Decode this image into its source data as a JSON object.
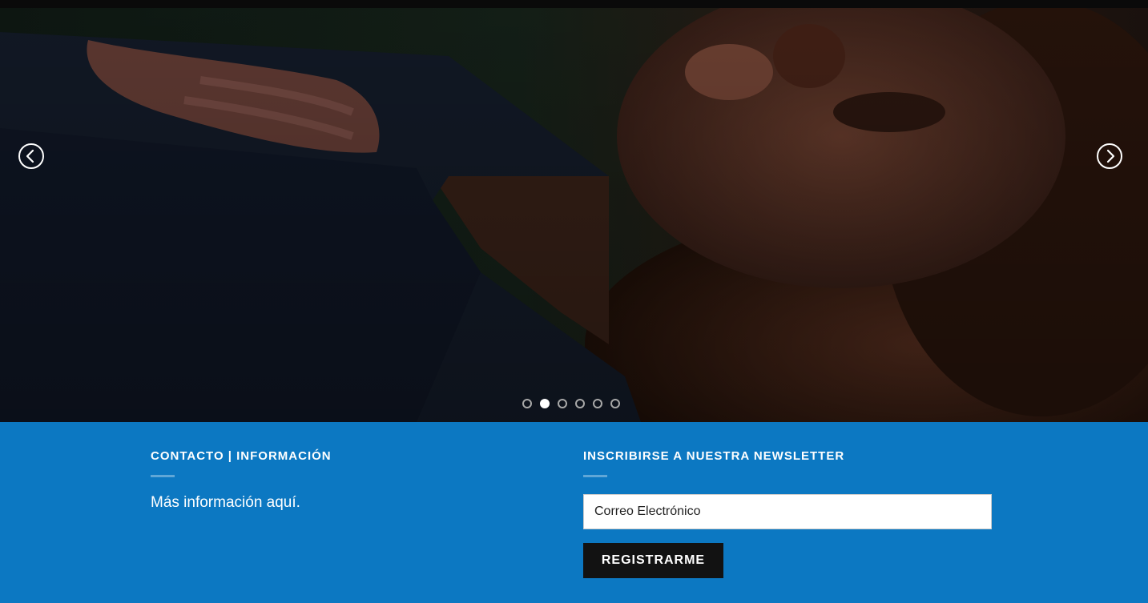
{
  "slider": {
    "prev_icon": "chevron-left-icon",
    "next_icon": "chevron-right-icon",
    "slides": [
      {
        "active": false
      },
      {
        "active": true
      },
      {
        "active": false
      },
      {
        "active": false
      },
      {
        "active": false
      },
      {
        "active": false
      }
    ]
  },
  "footer": {
    "contact": {
      "title": "CONTACTO | INFORMACIÓN",
      "text": "Más información aquí."
    },
    "newsletter": {
      "title": "INSCRIBIRSE A NUESTRA NEWSLETTER",
      "email_placeholder": "Correo Electrónico",
      "submit_label": "REGISTRARME"
    }
  },
  "colors": {
    "footer_bg": "#0c78c2",
    "button_bg": "#121212",
    "topbar": "#0a0a0a"
  }
}
